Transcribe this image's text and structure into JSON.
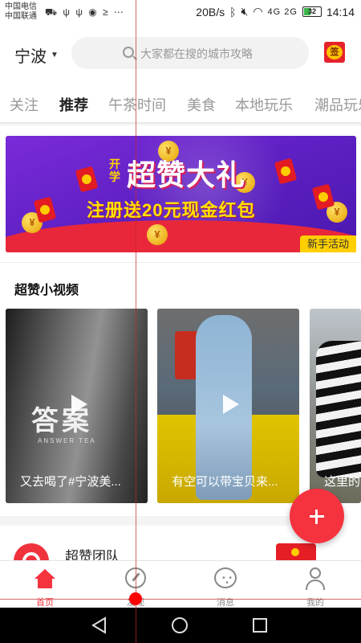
{
  "status_bar": {
    "carrier_1": "中国电信",
    "carrier_2": "中国联通",
    "speed": "20B/s",
    "network": "4G 2G",
    "battery": "32",
    "time": "14:14"
  },
  "header": {
    "city": "宁波",
    "search_placeholder": "大家都在搜的城市攻略",
    "checkin_label": "签"
  },
  "tabs": [
    {
      "label": "关注",
      "active": false
    },
    {
      "label": "推荐",
      "active": true
    },
    {
      "label": "午茶时间",
      "active": false
    },
    {
      "label": "美食",
      "active": false
    },
    {
      "label": "本地玩乐",
      "active": false
    },
    {
      "label": "潮品玩乐",
      "active": false
    }
  ],
  "banner": {
    "kai": "开学",
    "title": "超赞大礼",
    "subtitle": "注册送20元现金红包",
    "tag": "新手活动"
  },
  "videos": {
    "section_title": "超赞小视频",
    "items": [
      {
        "caption": "又去喝了#宁波美...",
        "logo": "答案",
        "logo_sub": "ANSWER TEA"
      },
      {
        "caption": "有空可以带宝贝来..."
      },
      {
        "caption": "这里的"
      }
    ]
  },
  "team": {
    "name": "超赞团队"
  },
  "bottom_nav": [
    {
      "label": "首页",
      "icon": "home-icon",
      "active": true
    },
    {
      "label": "发现",
      "icon": "compass-icon",
      "active": false
    },
    {
      "label": "消息",
      "icon": "message-icon",
      "active": false
    },
    {
      "label": "我的",
      "icon": "user-icon",
      "active": false
    }
  ],
  "colors": {
    "accent": "#f5333f",
    "banner_purple": "#5b1fc0",
    "banner_yellow": "#ffe300"
  }
}
